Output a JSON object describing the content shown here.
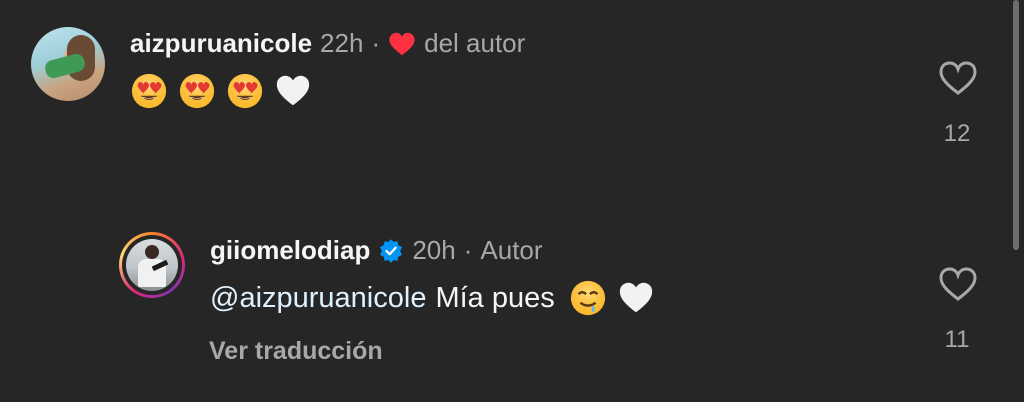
{
  "comments": [
    {
      "username": "aizpuruanicole",
      "time": "22h",
      "separator": "·",
      "author_tag": "del autor",
      "text": "",
      "emojis": [
        "heart-eyes",
        "heart-eyes",
        "heart-eyes",
        "white-heart"
      ],
      "like_count": "12"
    },
    {
      "username": "giiomelodiap",
      "time": "20h",
      "separator": "·",
      "author_tag": "Autor",
      "mention": "@aizpuruanicole",
      "text": "Mía pues",
      "emojis": [
        "drooling-face",
        "white-heart"
      ],
      "translate_label": "Ver traducción",
      "like_count": "11"
    }
  ],
  "colors": {
    "background": "#262626",
    "liked_heart": "#ff3040",
    "verified": "#0095f6",
    "secondary_text": "#a8a8a8"
  }
}
